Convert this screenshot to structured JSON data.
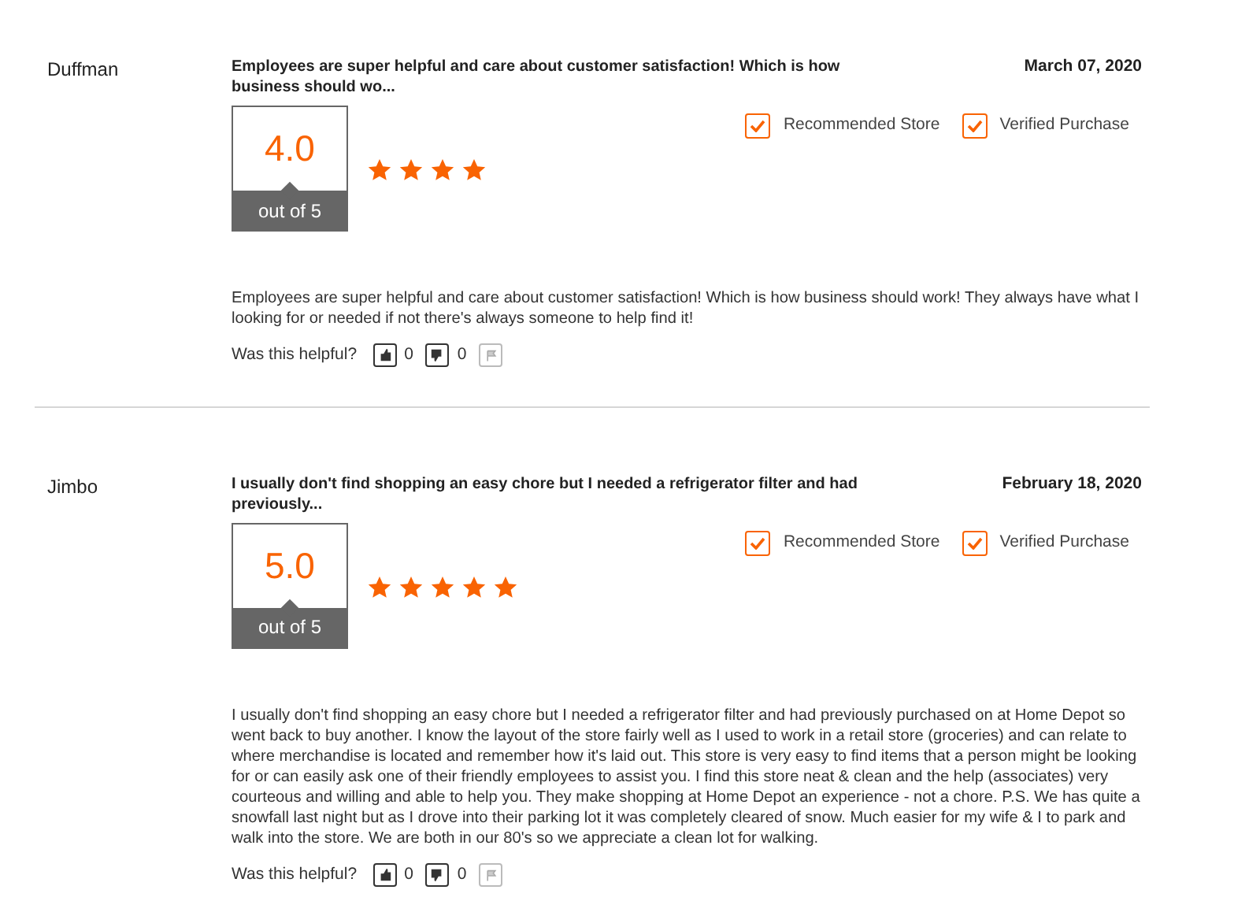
{
  "reviews": [
    {
      "reviewer": "Duffman",
      "title": "Employees are super helpful and care about customer satisfaction! Which is how business should wo...",
      "date": "March 07, 2020",
      "rating": "4.0",
      "scale": "out of 5",
      "stars": 4,
      "badges": [
        {
          "label": "Recommended Store",
          "checked": true
        },
        {
          "label": "Verified Purchase",
          "checked": true
        }
      ],
      "body": "Employees are super helpful and care about customer satisfaction! Which is how business should work! They always have what I looking for or needed if not there's always someone to help find it!",
      "helpful": {
        "label": "Was this helpful?",
        "up_count": "0",
        "down_count": "0"
      }
    },
    {
      "reviewer": "Jimbo",
      "title": "I usually don't find shopping an easy chore but I needed a refrigerator filter and had previously...",
      "date": "February 18, 2020",
      "rating": "5.0",
      "scale": "out of 5",
      "stars": 5,
      "badges": [
        {
          "label": "Recommended Store",
          "checked": true
        },
        {
          "label": "Verified Purchase",
          "checked": true
        }
      ],
      "body": "I usually don't find shopping an easy chore but I needed a refrigerator filter and had previously purchased on at Home Depot so went back to buy another. I know the layout of the store fairly well as I used to work in a retail store (groceries) and can relate to where merchandise is located and remember how it's laid out. This store is very easy to find items that a person might be looking for or can easily ask one of their friendly employees to assist you. I find this store neat & clean and the help (associates) very courteous and willing and able to help you. They make shopping at Home Depot an experience - not a chore. P.S. We has quite a snowfall last night but as I drove into their parking lot it was completely cleared of snow. Much easier for my wife & I to park and walk into the store. We are both in our 80's so we appreciate a clean lot for walking.",
      "helpful": {
        "label": "Was this helpful?",
        "up_count": "0",
        "down_count": "0"
      }
    }
  ]
}
